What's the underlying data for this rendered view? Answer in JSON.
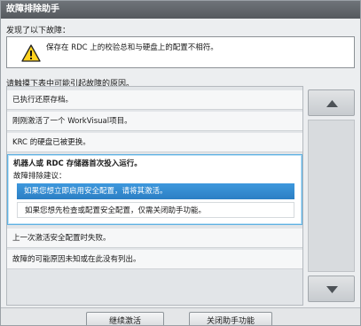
{
  "window": {
    "title": "故障排除助手"
  },
  "found": {
    "label": "发现了以下故障：",
    "error_message": "保存在 RDC 上的校验总和与硬盘上的配置不相符。",
    "icon": "warning-icon"
  },
  "instruction": "请触摸下表中可能引起故障的原因。",
  "causes": [
    {
      "label": "已执行还原存档。"
    },
    {
      "label": "刚刚激活了一个 WorkVisual项目。"
    },
    {
      "label": "KRC 的硬盘已被更换。"
    },
    {
      "label": "机器人或 RDC 存储器首次投入运行。",
      "selected": true,
      "suggestion_label": "故障排除建议：",
      "options": [
        {
          "label": "如果您想立即启用安全配置，请将其激活。",
          "active": true
        },
        {
          "label": "如果您想先检查或配置安全配置，仅需关闭助手功能。",
          "active": false
        }
      ]
    },
    {
      "label": "上一次激活安全配置时失败。"
    },
    {
      "label": "故障的可能原因未知或在此没有列出。"
    }
  ],
  "scroll": {
    "up_icon": "triangle-up-icon",
    "down_icon": "triangle-down-icon"
  },
  "buttons": {
    "reactivate": "继续激活",
    "close_assistant": "关闭助手功能"
  },
  "colors": {
    "title_bar": "#5f6368",
    "selection_border": "#5fb1e2",
    "active_option": "#2e86cf"
  }
}
